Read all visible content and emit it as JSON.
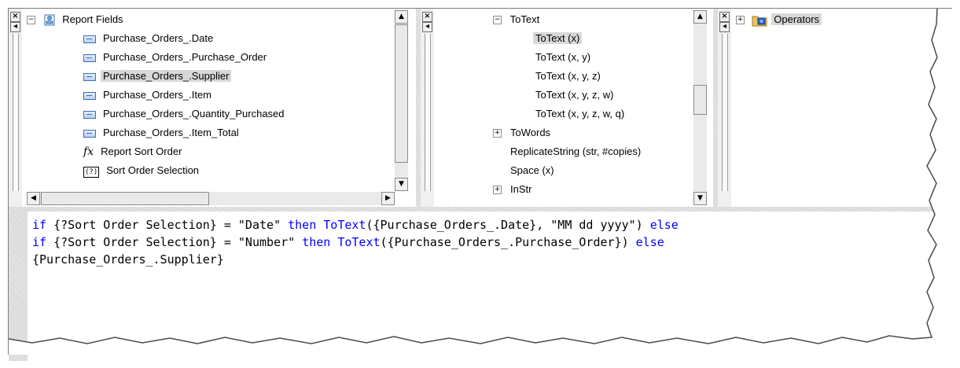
{
  "fields_pane": {
    "root_label": "Report Fields",
    "items": [
      {
        "label": "Purchase_Orders_.Date",
        "icon": "field-icon",
        "selected": false
      },
      {
        "label": "Purchase_Orders_.Purchase_Order",
        "icon": "field-icon",
        "selected": false
      },
      {
        "label": "Purchase_Orders_.Supplier",
        "icon": "field-icon",
        "selected": true
      },
      {
        "label": "Purchase_Orders_.Item",
        "icon": "field-icon",
        "selected": false
      },
      {
        "label": "Purchase_Orders_.Quantity_Purchased",
        "icon": "field-icon",
        "selected": false
      },
      {
        "label": "Purchase_Orders_.Item_Total",
        "icon": "field-icon",
        "selected": false
      },
      {
        "label": "Report Sort Order",
        "icon": "formula-icon",
        "selected": false
      },
      {
        "label": "Sort Order Selection",
        "icon": "parameter-icon",
        "selected": false
      }
    ],
    "param_icon_text": "(?)",
    "formula_icon_text": "fx"
  },
  "functions_pane": {
    "group_label": "ToText",
    "items": [
      {
        "label": "ToText (x)",
        "selected": true
      },
      {
        "label": "ToText (x, y)",
        "selected": false
      },
      {
        "label": "ToText (x, y, z)",
        "selected": false
      },
      {
        "label": "ToText (x, y, z, w)",
        "selected": false
      },
      {
        "label": "ToText (x, y, z, w, q)",
        "selected": false
      }
    ],
    "more": [
      {
        "label": "ToWords",
        "expandable": true
      },
      {
        "label": "ReplicateString (str, #copies)",
        "expandable": false
      },
      {
        "label": "Space (x)",
        "expandable": false
      },
      {
        "label": "InStr",
        "expandable": true
      }
    ]
  },
  "operators_pane": {
    "root_label": "Operators"
  },
  "editor": {
    "lines": [
      [
        {
          "t": "if",
          "c": "kw"
        },
        {
          "t": " {?Sort Order Selection} = ",
          "c": ""
        },
        {
          "t": "\"Date\"",
          "c": "str"
        },
        {
          "t": " ",
          "c": ""
        },
        {
          "t": "then",
          "c": "kw"
        },
        {
          "t": " ",
          "c": ""
        },
        {
          "t": "ToText",
          "c": "fn"
        },
        {
          "t": "({Purchase_Orders_.Date}, \"MM dd yyyy\") ",
          "c": ""
        },
        {
          "t": "else",
          "c": "kw"
        }
      ],
      [
        {
          "t": "if",
          "c": "kw"
        },
        {
          "t": " {?Sort Order Selection} = ",
          "c": ""
        },
        {
          "t": "\"Number\"",
          "c": "str"
        },
        {
          "t": " ",
          "c": ""
        },
        {
          "t": "then",
          "c": "kw"
        },
        {
          "t": " ",
          "c": ""
        },
        {
          "t": "ToText",
          "c": "fn"
        },
        {
          "t": "({Purchase_Orders_.Purchase_Order}) ",
          "c": ""
        },
        {
          "t": "else",
          "c": "kw"
        }
      ],
      [
        {
          "t": "{Purchase_Orders_.Supplier}",
          "c": ""
        }
      ]
    ]
  },
  "colors": {
    "keyword": "#0000ff",
    "selection": "#d8d8d8",
    "background": "#ffffff"
  }
}
